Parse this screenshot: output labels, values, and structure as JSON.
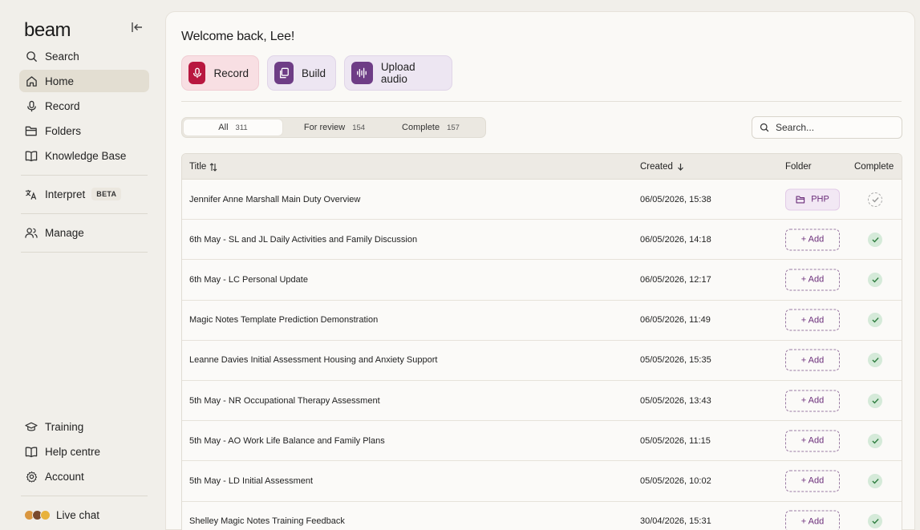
{
  "app": {
    "logo": "beam"
  },
  "sidebar": {
    "search_label": "Search",
    "home_label": "Home",
    "record_label": "Record",
    "folders_label": "Folders",
    "knowledge_label": "Knowledge Base",
    "interpret_label": "Interpret",
    "interpret_badge": "BETA",
    "manage_label": "Manage",
    "training_label": "Training",
    "help_label": "Help centre",
    "account_label": "Account",
    "livechat_label": "Live chat"
  },
  "header": {
    "welcome": "Welcome back, Lee!"
  },
  "actions": {
    "record_label": "Record",
    "build_label": "Build",
    "upload_label": "Upload audio",
    "record_color": "#b8173f",
    "build_color": "#6e3d86",
    "upload_color": "#6e3d86"
  },
  "tabs": {
    "all_label": "All",
    "all_count": "311",
    "review_label": "For review",
    "review_count": "154",
    "complete_label": "Complete",
    "complete_count": "157"
  },
  "search": {
    "placeholder": "Search..."
  },
  "table": {
    "headers": {
      "title": "Title",
      "created": "Created",
      "folder": "Folder",
      "complete": "Complete"
    },
    "rows": [
      {
        "title": "Jennifer Anne Marshall Main Duty Overview",
        "created": "06/05/2026, 15:38",
        "folder": "PHP",
        "complete": false
      },
      {
        "title": "6th May - SL and JL Daily Activities and Family Discussion",
        "created": "06/05/2026, 14:18",
        "folder": "+ Add",
        "complete": true
      },
      {
        "title": "6th May - LC Personal Update",
        "created": "06/05/2026, 12:17",
        "folder": "+ Add",
        "complete": true
      },
      {
        "title": "Magic Notes Template Prediction Demonstration",
        "created": "06/05/2026, 11:49",
        "folder": "+ Add",
        "complete": true
      },
      {
        "title": "Leanne Davies Initial Assessment Housing and Anxiety Support",
        "created": "05/05/2026, 15:35",
        "folder": "+ Add",
        "complete": true
      },
      {
        "title": "5th May - NR Occupational Therapy Assessment",
        "created": "05/05/2026, 13:43",
        "folder": "+ Add",
        "complete": true
      },
      {
        "title": "5th May - AO Work Life Balance and Family Plans",
        "created": "05/05/2026, 11:15",
        "folder": "+ Add",
        "complete": true
      },
      {
        "title": "5th May - LD Initial Assessment",
        "created": "05/05/2026, 10:02",
        "folder": "+ Add",
        "complete": true
      },
      {
        "title": "Shelley Magic Notes Training Feedback",
        "created": "30/04/2026, 15:31",
        "folder": "+ Add",
        "complete": true
      }
    ]
  }
}
